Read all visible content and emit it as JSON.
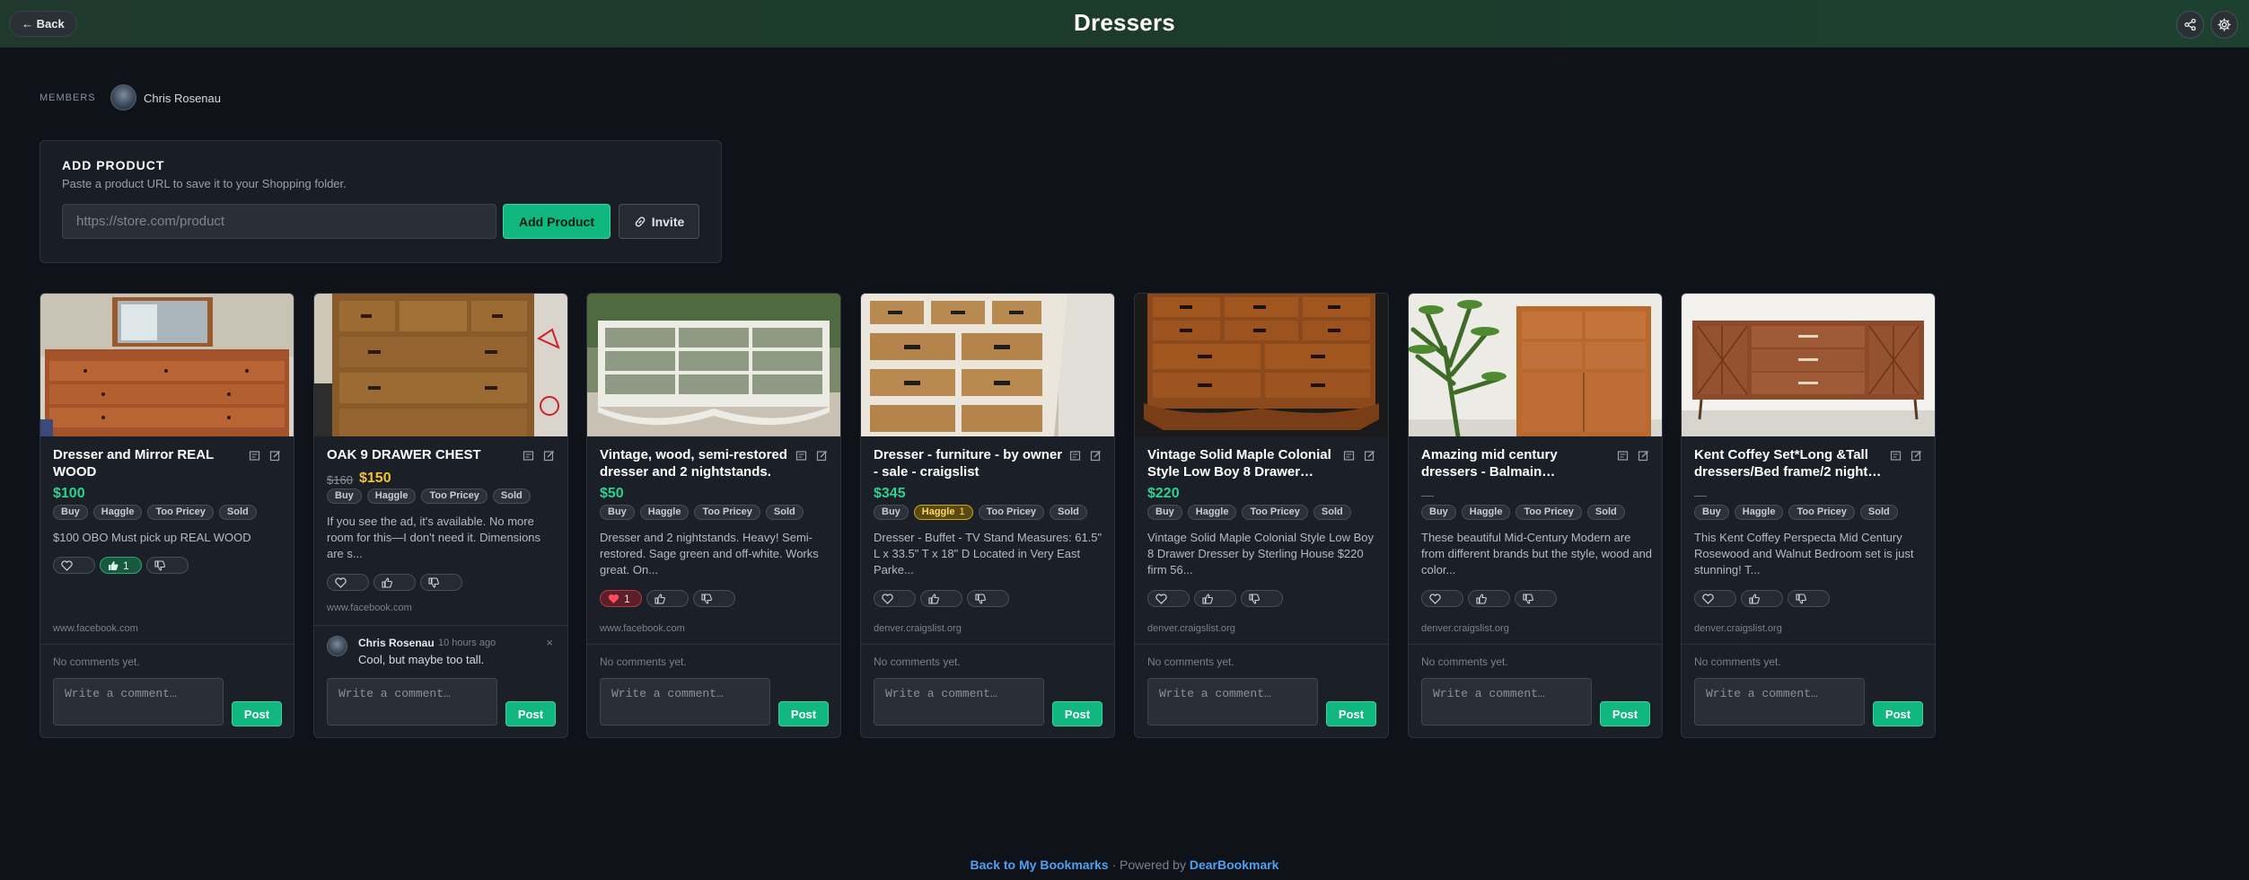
{
  "header": {
    "back_label": "← Back",
    "title": "Dressers"
  },
  "members": {
    "label": "MEMBERS",
    "names": [
      "Chris Rosenau"
    ]
  },
  "add_product": {
    "title": "ADD PRODUCT",
    "subtitle": "Paste a product URL to save it to your Shopping folder.",
    "url_placeholder": "https://store.com/product",
    "add_label": "Add Product",
    "invite_label": "Invite"
  },
  "tag_labels": [
    "Buy",
    "Haggle",
    "Too Pricey",
    "Sold"
  ],
  "comment_placeholder": "Write a comment…",
  "post_label": "Post",
  "no_comments_text": "No comments yet.",
  "cards": [
    {
      "title_lines": [
        "Dresser and Mirror REAL",
        "WOOD"
      ],
      "price": "$100",
      "description_lines": [
        "$100 OBO Must pick up REAL WOOD"
      ],
      "domain": "www.facebook.com",
      "like_count": "1"
    },
    {
      "title_lines": [
        "OAK 9 DRAWER CHEST"
      ],
      "price_old": "$160",
      "price_new": "$150",
      "description_lines": [
        "If you see the ad, it's available. No more",
        "room for this—I don't need it. Dimensions",
        "are s..."
      ],
      "domain": "www.facebook.com",
      "comment": {
        "author": "Chris Rosenau",
        "time": "10 hours ago",
        "text": "Cool, but maybe too tall."
      }
    },
    {
      "title_lines": [
        "Vintage, wood, semi-restored",
        "dresser and 2 nightstands."
      ],
      "price": "$50",
      "description_lines": [
        "Dresser and 2 nightstands. Heavy! Semi-",
        "restored. Sage green and off-white. Works",
        "great. On..."
      ],
      "domain": "www.facebook.com",
      "love_count": "1"
    },
    {
      "title_lines": [
        "Dresser - furniture - by owner",
        "- sale - craigslist"
      ],
      "price": "$345",
      "haggle_count": "1",
      "description_lines": [
        "Dresser - Buffet - TV Stand Measures: 61.5\"",
        "L x 33.5\" T x 18\" D Located in Very East",
        "Parke..."
      ],
      "domain": "denver.craigslist.org"
    },
    {
      "title_lines": [
        "Vintage Solid Maple Colonial",
        "Style Low Boy 8 Drawer…"
      ],
      "price": "$220",
      "description_lines": [
        "Vintage Solid Maple Colonial Style Low Boy",
        "8 Drawer Dresser by Sterling House $220",
        "firm 56..."
      ],
      "domain": "denver.craigslist.org"
    },
    {
      "title_lines": [
        "Amazing mid century",
        "dressers - Balmain…"
      ],
      "price": "—",
      "description_lines": [
        "These beautiful Mid-Century Modern are",
        "from different brands but the style, wood and",
        "color..."
      ],
      "domain": "denver.craigslist.org"
    },
    {
      "title_lines": [
        "Kent Coffey Set*Long &Tall",
        "dressers/Bed frame/2 night…"
      ],
      "price": "—",
      "description_lines": [
        "This Kent Coffey Perspecta Mid Century",
        "Rosewood and Walnut Bedroom set is just",
        "stunning! T..."
      ],
      "domain": "denver.craigslist.org"
    }
  ],
  "footer": {
    "link_label": "Back to My Bookmarks",
    "separator": " · Powered by ",
    "brand": "DearBookmark"
  },
  "colors": {
    "accent_green": "#10b77e",
    "price_green": "#2ad38f",
    "sale_yellow": "#f4c430",
    "link_blue": "#4ea0f0",
    "background": "#0f1219"
  },
  "icons": [
    "arrow-left-icon",
    "share-icon",
    "gear-icon",
    "link-icon",
    "notes-icon",
    "edit-icon",
    "heart-icon",
    "thumbs-up-icon",
    "thumbs-down-icon",
    "close-icon"
  ]
}
